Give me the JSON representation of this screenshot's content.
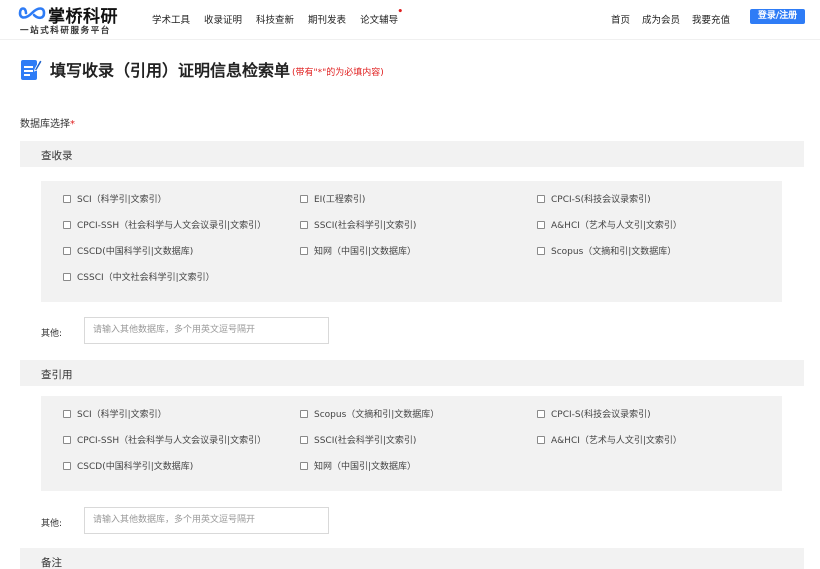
{
  "brand": {
    "name": "掌桥科研",
    "tagline": "一站式科研服务平台"
  },
  "nav": {
    "items": [
      "学术工具",
      "收录证明",
      "科技查新",
      "期刊发表",
      "论文辅导"
    ],
    "badge": "•",
    "right": [
      "首页",
      "成为会员",
      "我要充值"
    ],
    "login": "登录/注册"
  },
  "page": {
    "title": "填写收录（引用）证明信息检索单",
    "note": "(带有\"*\"的为必填内容)",
    "db_label": "数据库选择",
    "required_mark": "*"
  },
  "collection": {
    "label": "查收录",
    "options": [
      "SCI（科学引|文索引）",
      "EI(工程索引)",
      "CPCI-S(科技会议录索引)",
      "CPCI-SSH（社会科学与人文会议录引|文索引）",
      "SSCI(社会科学引|文索引)",
      "A&HCI（艺术与人文引|文索引）",
      "CSCD(中国科学引|文数据库)",
      "知网（中国引|文数据库）",
      "Scopus（文摘和引|文数据库）",
      "CSSCI（中文社会科学引|文索引）"
    ],
    "other_label": "其他:",
    "other_placeholder": "请输入其他数据库，多个用英文逗号隔开"
  },
  "citation": {
    "label": "查引用",
    "options": [
      "SCI（科学引|文索引）",
      "Scopus（文摘和引|文数据库）",
      "CPCI-S(科技会议录索引)",
      "CPCI-SSH（社会科学与人文会议录引|文索引）",
      "SSCI(社会科学引|文索引)",
      "A&HCI（艺术与人文引|文索引）",
      "CSCD(中国科学引|文数据库)",
      "知网（中国引|文数据库）"
    ],
    "other_label": "其他:",
    "other_placeholder": "请输入其他数据库，多个用英文逗号隔开"
  },
  "remarks": {
    "label": "备注"
  },
  "colors": {
    "accent": "#2e7cf6",
    "required": "#e02020",
    "panel": "#f2f2f2"
  }
}
